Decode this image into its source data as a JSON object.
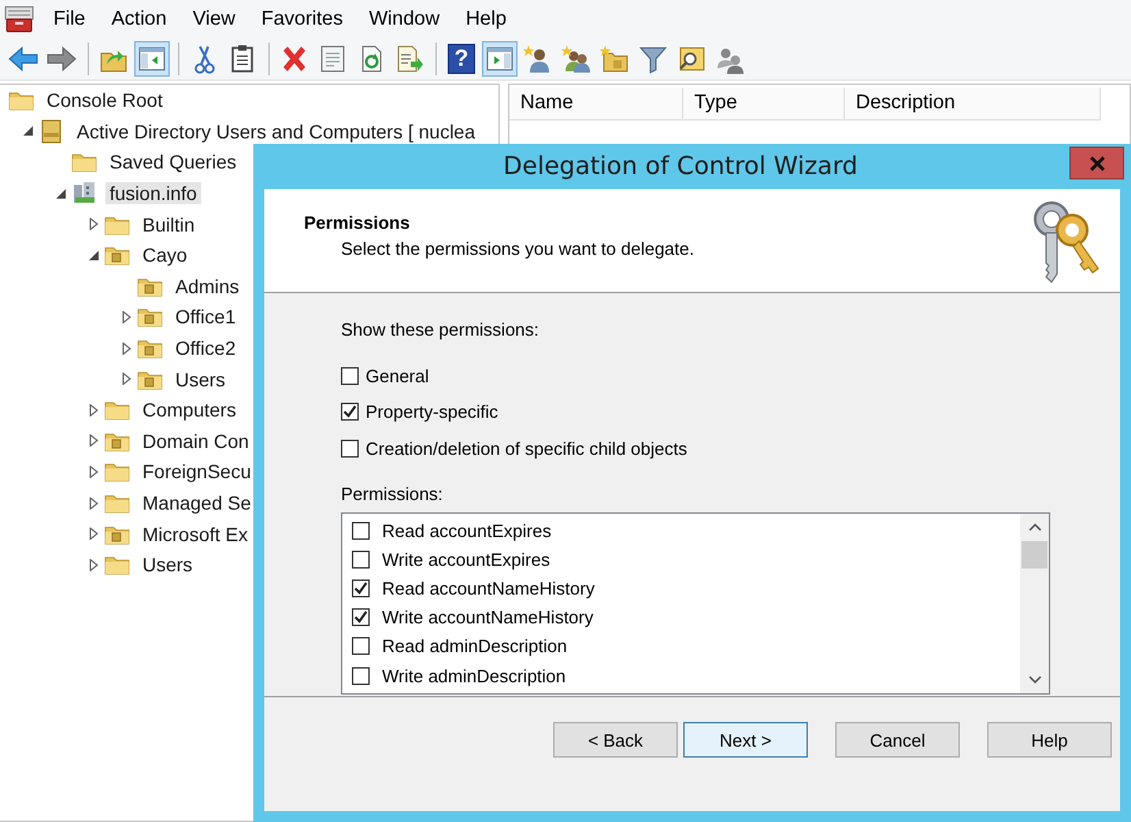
{
  "menu": [
    "File",
    "Action",
    "View",
    "Favorites",
    "Window",
    "Help"
  ],
  "toolbar": [
    {
      "kind": "back",
      "pressed": false
    },
    {
      "kind": "forward",
      "pressed": false
    },
    {
      "kind": "separator"
    },
    {
      "kind": "up",
      "pressed": false
    },
    {
      "kind": "tree-pane",
      "pressed": true
    },
    {
      "kind": "separator"
    },
    {
      "kind": "cut",
      "pressed": false
    },
    {
      "kind": "paste",
      "pressed": false
    },
    {
      "kind": "separator"
    },
    {
      "kind": "delete",
      "pressed": false
    },
    {
      "kind": "properties",
      "pressed": false
    },
    {
      "kind": "refresh",
      "pressed": false
    },
    {
      "kind": "export",
      "pressed": false
    },
    {
      "kind": "separator"
    },
    {
      "kind": "help",
      "pressed": false,
      "glyph": "?"
    },
    {
      "kind": "action-pane",
      "pressed": true
    },
    {
      "kind": "new-user",
      "pressed": false
    },
    {
      "kind": "new-group",
      "pressed": false
    },
    {
      "kind": "new-ou",
      "pressed": false
    },
    {
      "kind": "filter",
      "pressed": false
    },
    {
      "kind": "find",
      "pressed": false
    },
    {
      "kind": "people",
      "pressed": false
    }
  ],
  "tree": [
    {
      "label": "Console Root",
      "kind": "folder",
      "selected": false,
      "children": [
        {
          "label": "Active Directory Users and Computers [ nuclea",
          "kind": "snapin",
          "selected": false,
          "expanded": true,
          "children": [
            {
              "label": "Saved Queries",
              "kind": "folder",
              "selected": false
            },
            {
              "label": "fusion.info",
              "kind": "domain",
              "selected": true,
              "expanded": true,
              "children": [
                {
                  "label": "Builtin",
                  "kind": "folder",
                  "selected": false,
                  "expanded": false
                },
                {
                  "label": "Cayo",
                  "kind": "ou",
                  "selected": false,
                  "expanded": true,
                  "children": [
                    {
                      "label": "Admins",
                      "kind": "ou",
                      "selected": false
                    },
                    {
                      "label": "Office1",
                      "kind": "ou",
                      "selected": false,
                      "expanded": false
                    },
                    {
                      "label": "Office2",
                      "kind": "ou",
                      "selected": false,
                      "expanded": false
                    },
                    {
                      "label": "Users",
                      "kind": "ou",
                      "selected": false,
                      "expanded": false
                    }
                  ]
                },
                {
                  "label": "Computers",
                  "kind": "folder",
                  "selected": false,
                  "expanded": false
                },
                {
                  "label": "Domain Con",
                  "kind": "ou",
                  "selected": false,
                  "expanded": false
                },
                {
                  "label": "ForeignSecu",
                  "kind": "folder",
                  "selected": false,
                  "expanded": false
                },
                {
                  "label": "Managed Se",
                  "kind": "folder",
                  "selected": false,
                  "expanded": false
                },
                {
                  "label": "Microsoft Ex",
                  "kind": "ou",
                  "selected": false,
                  "expanded": false
                },
                {
                  "label": "Users",
                  "kind": "folder",
                  "selected": false,
                  "expanded": false
                }
              ]
            }
          ]
        }
      ]
    }
  ],
  "list": {
    "columns": [
      "Name",
      "Type",
      "Description"
    ]
  },
  "dialog": {
    "title": "Delegation of Control Wizard",
    "header": {
      "title": "Permissions",
      "subtitle": "Select the permissions you want to delegate."
    },
    "show_label": "Show these permissions:",
    "filters": [
      {
        "label": "General",
        "checked": false
      },
      {
        "label": "Property-specific",
        "checked": true
      },
      {
        "label": "Creation/deletion of specific child objects",
        "checked": false
      }
    ],
    "permissions_label": "Permissions:",
    "permissions": [
      {
        "label": "Read accountExpires",
        "checked": false
      },
      {
        "label": "Write accountExpires",
        "checked": false
      },
      {
        "label": "Read accountNameHistory",
        "checked": true
      },
      {
        "label": "Write accountNameHistory",
        "checked": true
      },
      {
        "label": "Read adminDescription",
        "checked": false
      },
      {
        "label": "Write adminDescription",
        "checked": false
      }
    ],
    "buttons": [
      {
        "kind": "back",
        "label": "< Back",
        "focused": false
      },
      {
        "kind": "next",
        "label": "Next >",
        "focused": true
      },
      {
        "kind": "cancel",
        "label": "Cancel",
        "focused": false
      },
      {
        "kind": "help",
        "label": "Help",
        "focused": false
      }
    ]
  }
}
